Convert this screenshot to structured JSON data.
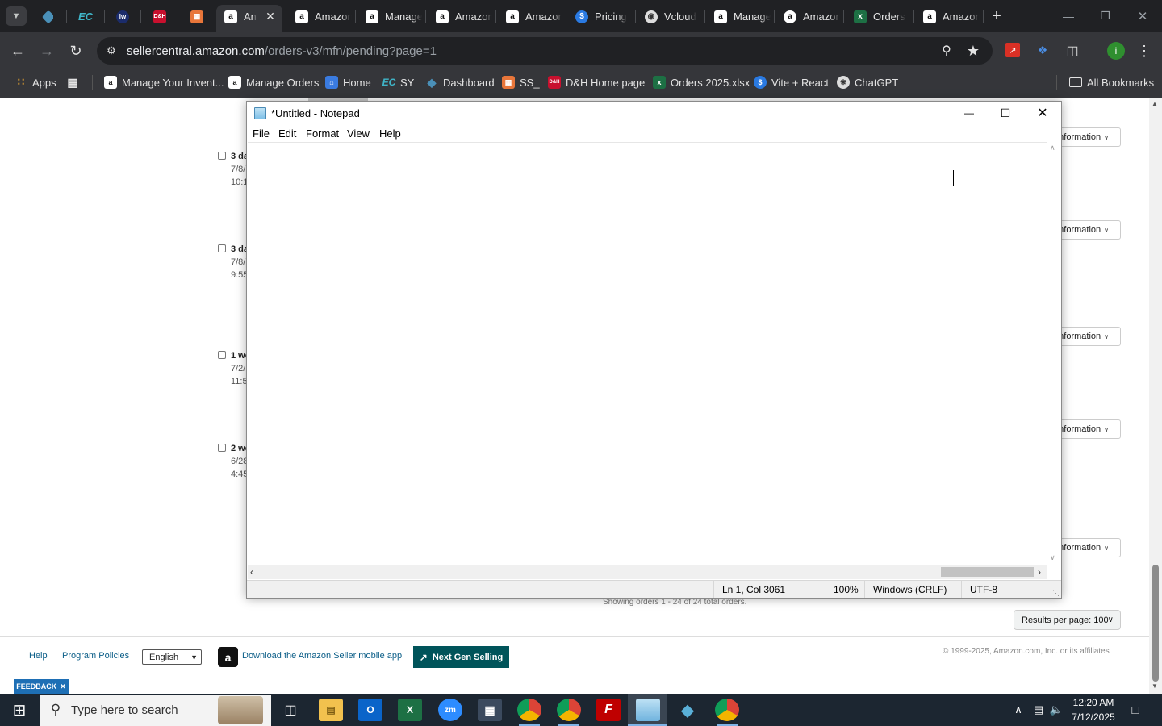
{
  "browser": {
    "tabs": [
      {
        "title": "",
        "icon": "dashboard-icon"
      },
      {
        "title": "",
        "icon": "ec-icon"
      },
      {
        "title": "",
        "icon": "lw-icon"
      },
      {
        "title": "",
        "icon": "dh-icon"
      },
      {
        "title": "",
        "icon": "box-icon"
      },
      {
        "title": "An",
        "icon": "amazon-icon",
        "active": true
      },
      {
        "title": "Amazon",
        "icon": "amazon-icon"
      },
      {
        "title": "Manage",
        "icon": "amazon-icon"
      },
      {
        "title": "Amazon",
        "icon": "amazon-icon"
      },
      {
        "title": "Amazon",
        "icon": "amazon-icon"
      },
      {
        "title": "Pricing",
        "icon": "dollar-icon"
      },
      {
        "title": "Vcloud",
        "icon": "vcloud-icon"
      },
      {
        "title": "Manage",
        "icon": "amazon-icon"
      },
      {
        "title": "Amazon",
        "icon": "amazon-icon"
      },
      {
        "title": "Orders",
        "icon": "excel-icon"
      },
      {
        "title": "Amazon",
        "icon": "amazon-icon"
      }
    ],
    "url_host": "sellercentral.amazon.com",
    "url_path": "/orders-v3/mfn/pending?page=1",
    "bookmarks": [
      {
        "label": "Apps"
      },
      {
        "label": "Manage Your Invent..."
      },
      {
        "label": "Manage Orders"
      },
      {
        "label": "Home"
      },
      {
        "label": "SY"
      },
      {
        "label": "Dashboard"
      },
      {
        "label": "SS_"
      },
      {
        "label": "D&H Home page"
      },
      {
        "label": "Orders 2025.xlsx"
      },
      {
        "label": "Vite + React"
      },
      {
        "label": "ChatGPT"
      }
    ],
    "all_bookmarks": "All Bookmarks",
    "profile_initial": "i"
  },
  "page": {
    "orders": [
      {
        "age": "3 da",
        "date": "7/8/",
        "time": "10:1"
      },
      {
        "age": "3 da",
        "date": "7/8/",
        "time": "9:55"
      },
      {
        "age": "1 we",
        "date": "7/2/",
        "time": "11:5"
      },
      {
        "age": "2 we",
        "date": "6/28",
        "time": "4:45"
      }
    ],
    "info_button_label": "nformation",
    "showing_text": "Showing orders 1 - 24 of 24 total orders.",
    "results_per_page": "Results per page: 100",
    "footer": {
      "help": "Help",
      "policies": "Program Policies",
      "language": "English",
      "app_download": "Download the Amazon Seller mobile app",
      "next_gen": "Next Gen Selling",
      "copyright": "© 1999-2025, Amazon.com, Inc. or its affiliates"
    },
    "feedback": "FEEDBACK"
  },
  "notepad": {
    "title": "*Untitled - Notepad",
    "menu": [
      "File",
      "Edit",
      "Format",
      "View",
      "Help"
    ],
    "status": {
      "position": "Ln 1, Col 3061",
      "zoom": "100%",
      "line_ending": "Windows (CRLF)",
      "encoding": "UTF-8"
    }
  },
  "taskbar": {
    "search_placeholder": "Type here to search",
    "time": "12:20 AM",
    "date": "7/12/2025"
  }
}
